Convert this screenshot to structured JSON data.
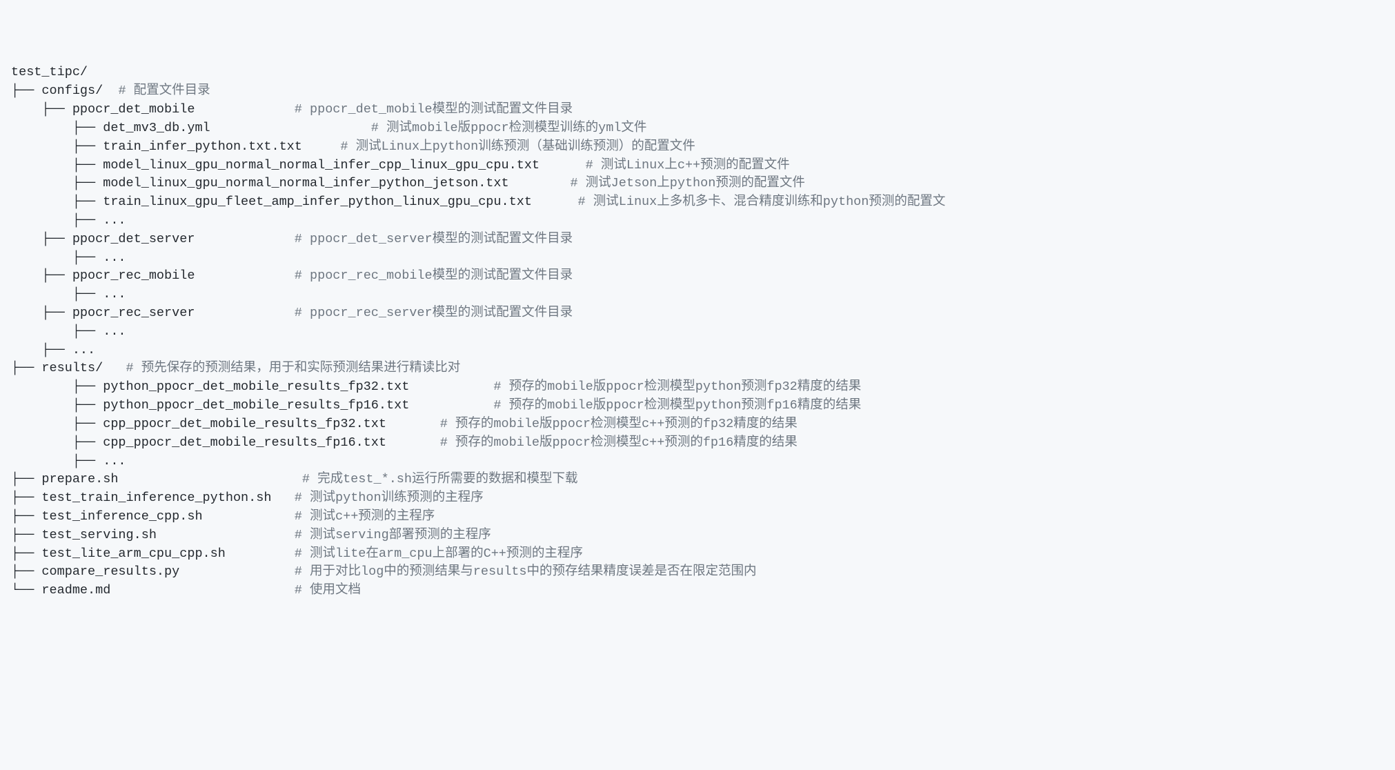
{
  "lines": [
    {
      "t": "test_tipc/",
      "c": ""
    },
    {
      "t": "├── configs/  ",
      "c": "# 配置文件目录"
    },
    {
      "t": "    ├── ppocr_det_mobile             ",
      "c": "# ppocr_det_mobile模型的测试配置文件目录"
    },
    {
      "t": "        ├── det_mv3_db.yml                     ",
      "c": "# 测试mobile版ppocr检测模型训练的yml文件"
    },
    {
      "t": "        ├── train_infer_python.txt.txt     ",
      "c": "# 测试Linux上python训练预测（基础训练预测）的配置文件"
    },
    {
      "t": "        ├── model_linux_gpu_normal_normal_infer_cpp_linux_gpu_cpu.txt      ",
      "c": "# 测试Linux上c++预测的配置文件"
    },
    {
      "t": "        ├── model_linux_gpu_normal_normal_infer_python_jetson.txt        ",
      "c": "# 测试Jetson上python预测的配置文件"
    },
    {
      "t": "        ├── train_linux_gpu_fleet_amp_infer_python_linux_gpu_cpu.txt      ",
      "c": "# 测试Linux上多机多卡、混合精度训练和python预测的配置文"
    },
    {
      "t": "        ├── ...  ",
      "c": ""
    },
    {
      "t": "    ├── ppocr_det_server             ",
      "c": "# ppocr_det_server模型的测试配置文件目录"
    },
    {
      "t": "        ├── ...  ",
      "c": ""
    },
    {
      "t": "    ├── ppocr_rec_mobile             ",
      "c": "# ppocr_rec_mobile模型的测试配置文件目录"
    },
    {
      "t": "        ├── ...  ",
      "c": ""
    },
    {
      "t": "    ├── ppocr_rec_server             ",
      "c": "# ppocr_rec_server模型的测试配置文件目录"
    },
    {
      "t": "        ├── ...  ",
      "c": ""
    },
    {
      "t": "    ├── ...   ",
      "c": ""
    },
    {
      "t": "├── results/   ",
      "c": "# 预先保存的预测结果，用于和实际预测结果进行精读比对"
    },
    {
      "t": "        ├── python_ppocr_det_mobile_results_fp32.txt           ",
      "c": "# 预存的mobile版ppocr检测模型python预测fp32精度的结果"
    },
    {
      "t": "        ├── python_ppocr_det_mobile_results_fp16.txt           ",
      "c": "# 预存的mobile版ppocr检测模型python预测fp16精度的结果"
    },
    {
      "t": "        ├── cpp_ppocr_det_mobile_results_fp32.txt       ",
      "c": "# 预存的mobile版ppocr检测模型c++预测的fp32精度的结果"
    },
    {
      "t": "        ├── cpp_ppocr_det_mobile_results_fp16.txt       ",
      "c": "# 预存的mobile版ppocr检测模型c++预测的fp16精度的结果"
    },
    {
      "t": "        ├── ...  ",
      "c": ""
    },
    {
      "t": "├── prepare.sh                        ",
      "c": "# 完成test_*.sh运行所需要的数据和模型下载"
    },
    {
      "t": "├── test_train_inference_python.sh   ",
      "c": "# 测试python训练预测的主程序"
    },
    {
      "t": "├── test_inference_cpp.sh            ",
      "c": "# 测试c++预测的主程序"
    },
    {
      "t": "├── test_serving.sh                  ",
      "c": "# 测试serving部署预测的主程序"
    },
    {
      "t": "├── test_lite_arm_cpu_cpp.sh         ",
      "c": "# 测试lite在arm_cpu上部署的C++预测的主程序"
    },
    {
      "t": "├── compare_results.py               ",
      "c": "# 用于对比log中的预测结果与results中的预存结果精度误差是否在限定范围内"
    },
    {
      "t": "└── readme.md                        ",
      "c": "# 使用文档"
    }
  ]
}
